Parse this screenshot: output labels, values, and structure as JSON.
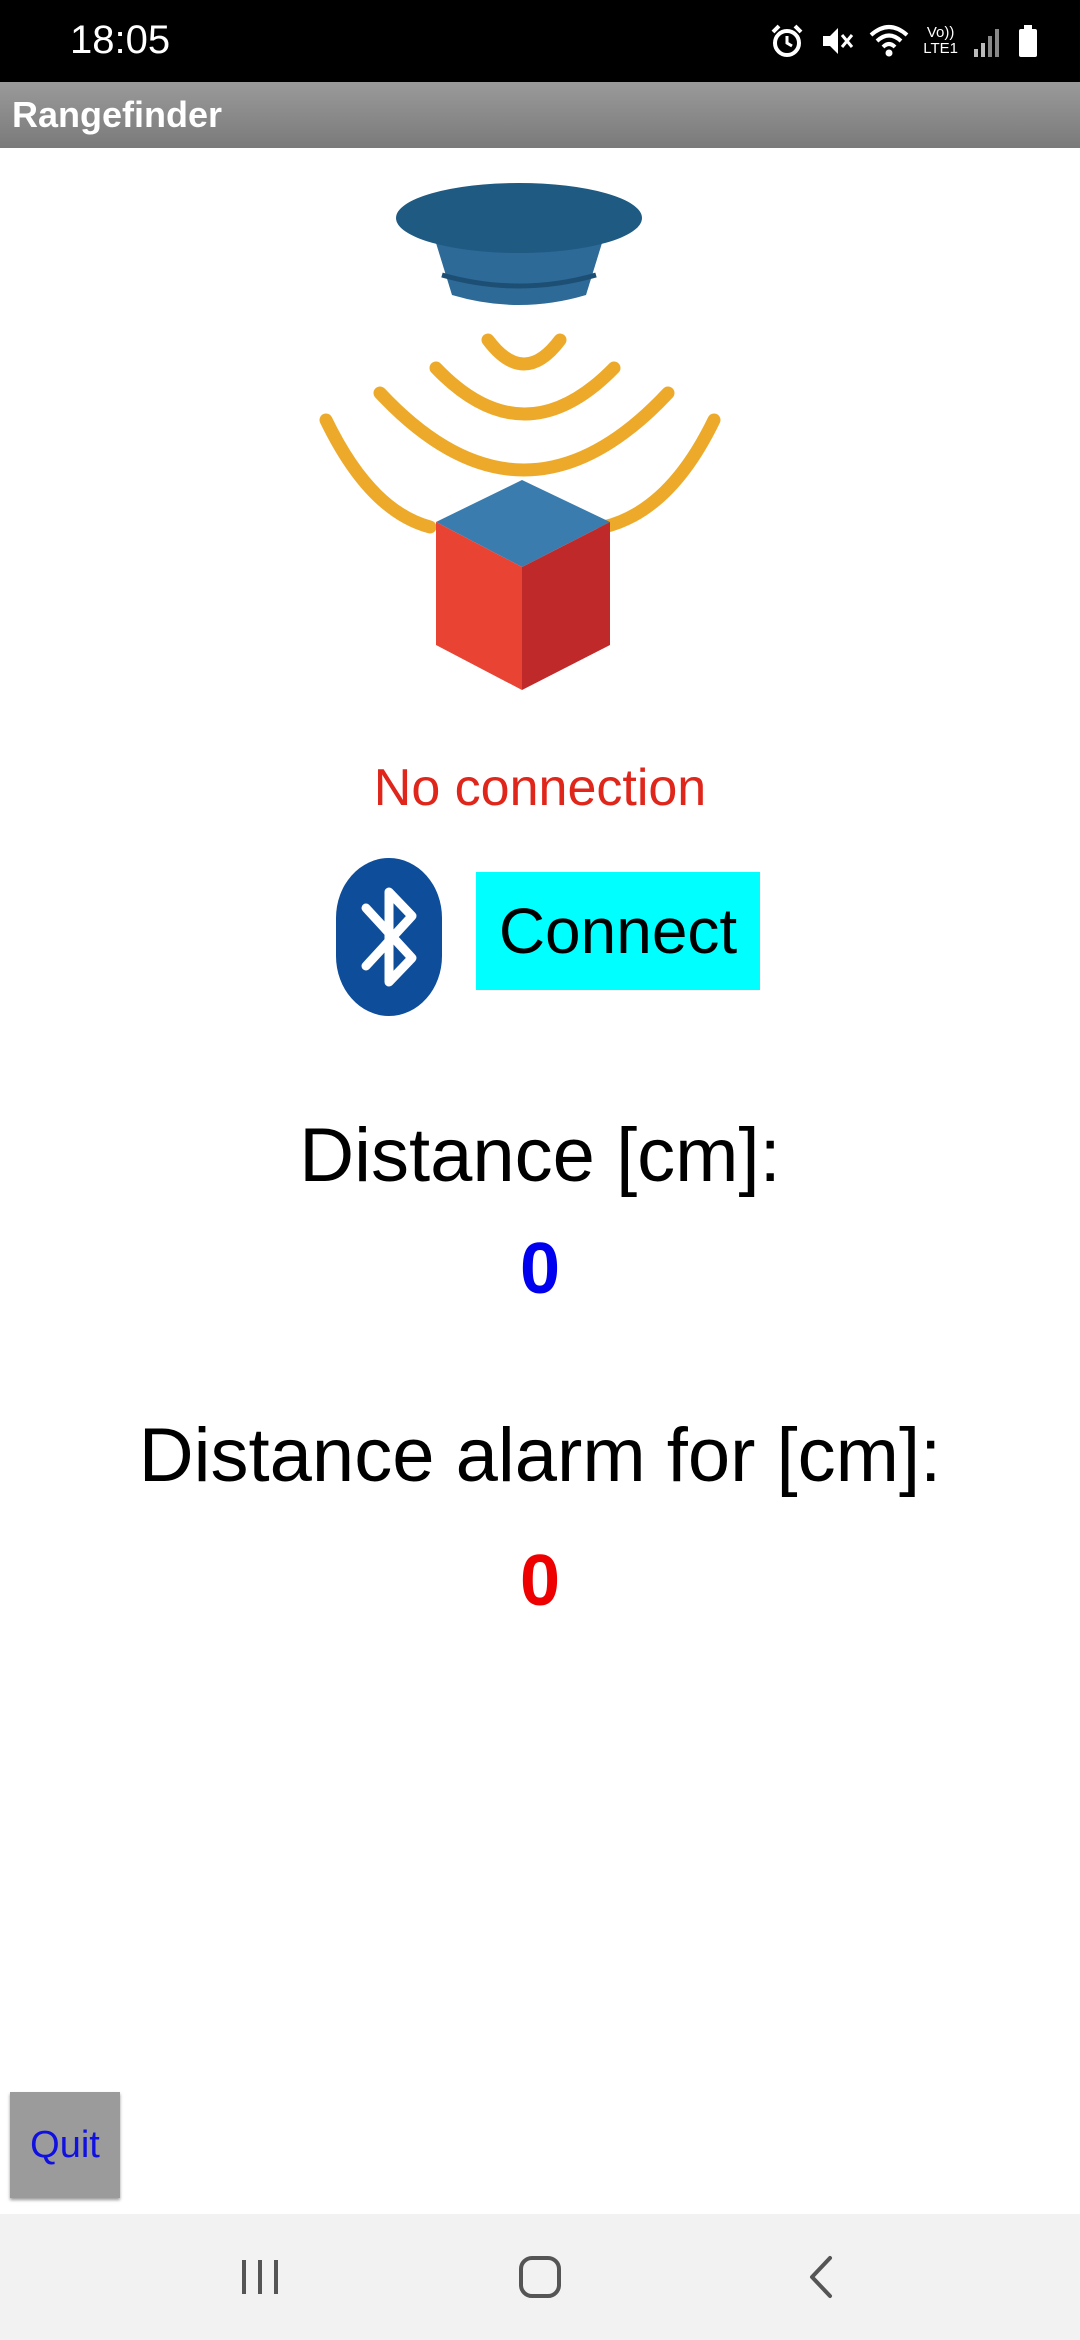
{
  "status_bar": {
    "time": "18:05",
    "icons": [
      "alarm-icon",
      "mute-icon",
      "wifi-icon",
      "volte-icon",
      "signal-icon",
      "battery-icon"
    ],
    "volte_line1": "Vo))",
    "volte_line2": "LTE1"
  },
  "app": {
    "title": "Rangefinder"
  },
  "connection": {
    "status": "No connection",
    "status_color": "#e0261b",
    "connect_label": "Connect",
    "connect_color": "#00ffff"
  },
  "distance": {
    "label": "Distance [cm]:",
    "value": "0",
    "value_color": "#0000ee"
  },
  "alarm": {
    "label": "Distance alarm for [cm]:",
    "value": "0",
    "value_color": "#ee0000"
  },
  "footer": {
    "quit_label": "Quit"
  },
  "nav": {
    "items": [
      "recent-apps-icon",
      "home-icon",
      "back-icon"
    ]
  }
}
